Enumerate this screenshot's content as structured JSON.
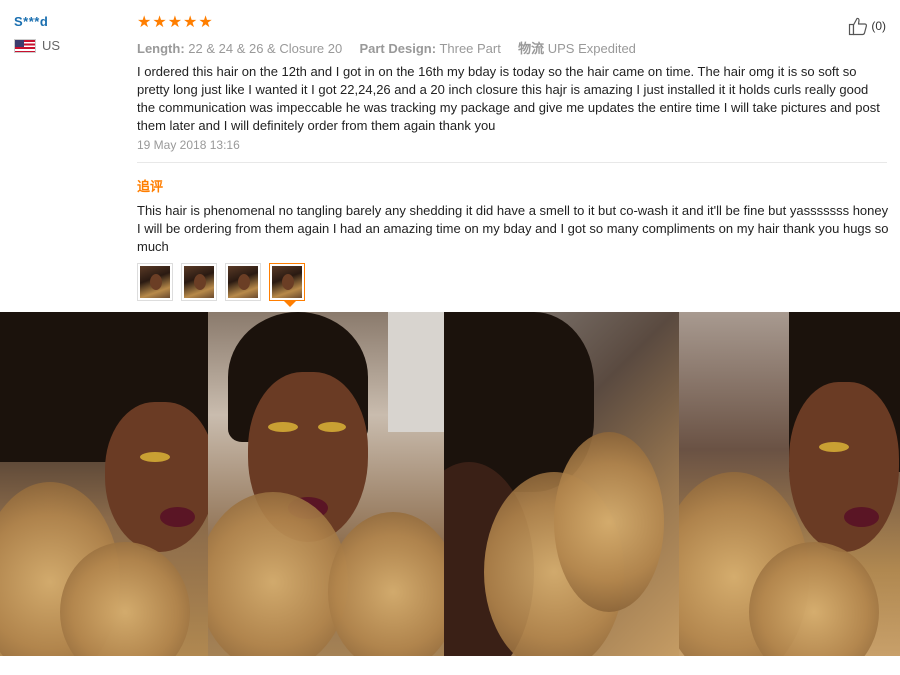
{
  "review": {
    "username": "S***d",
    "country": "US",
    "rating": 5,
    "stars": [
      "★",
      "★",
      "★",
      "★",
      "★"
    ],
    "helpful": "(0)",
    "attributes": {
      "length_label": "Length:",
      "length_value": "22 & 24 & 26 & Closure 20",
      "part_label": "Part Design:",
      "part_value": "Three Part",
      "ship_label": "物流",
      "ship_value": "UPS Expedited"
    },
    "text": "I ordered this hair on the 12th and I got in on the 16th my bday is today so the hair came on time. The hair omg it is so soft so pretty long just like I wanted it I got 22,24,26 and a 20 inch closure this hajr is amazing I just installed it it holds curls really good the communication was impeccable he was tracking my package and give me updates the entire time I will take pictures and post them later and I will definitely order from them again thank you",
    "date": "19 May 2018 13:16",
    "followup_label": "追评",
    "followup_text": "This hair is phenomenal no tangling barely any shedding it did have a smell to it but co-wash it and it'll be fine but yasssssss honey I will be ordering from them again I had an amazing time on my bday and I got so many compliments on my hair thank you hugs so much",
    "thumbnails_count": 4,
    "selected_thumbnail": 4
  },
  "colors": {
    "accent": "#ff7e00",
    "username": "#1a6fb0",
    "muted": "#999999"
  }
}
